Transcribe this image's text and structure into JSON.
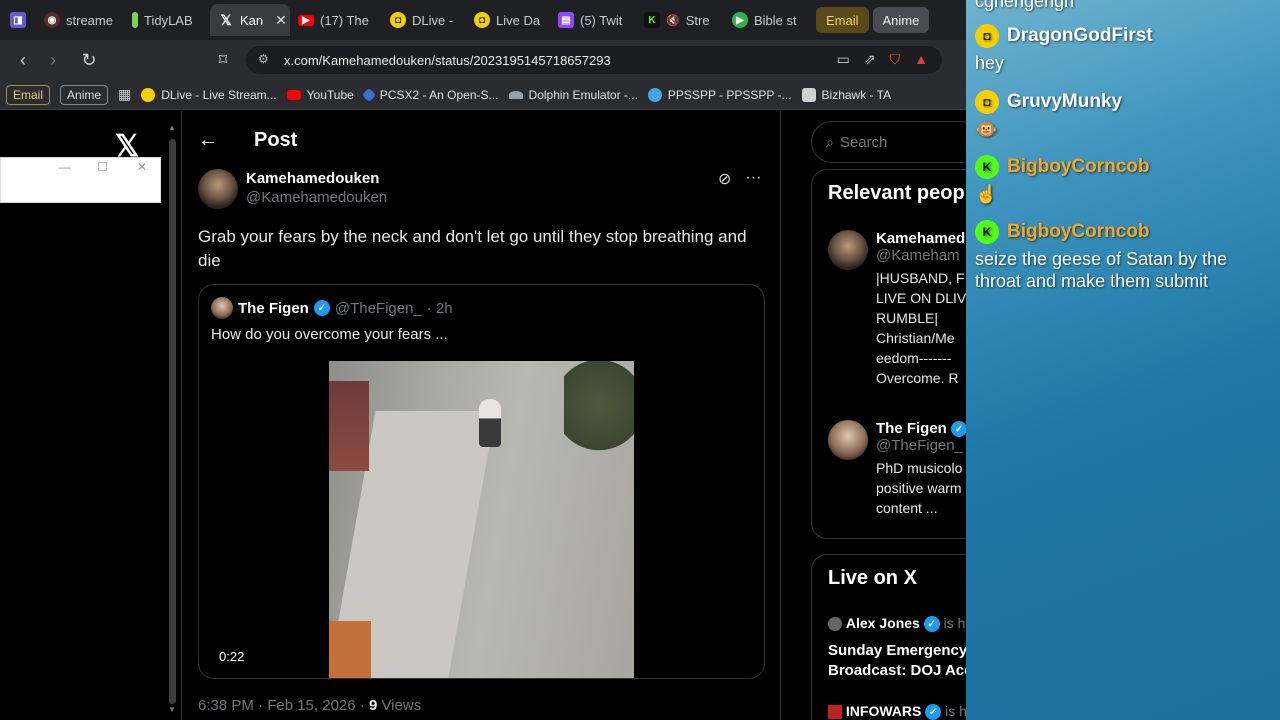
{
  "tabs": [
    {
      "label": "streame",
      "icon": "streamer-icon",
      "color": "#c4403a"
    },
    {
      "label": "TidyLAB",
      "icon": "flask-icon",
      "color": "#7bd44f"
    },
    {
      "label": "Kan",
      "icon": "x-logo-icon",
      "color": "#000000",
      "active": true
    },
    {
      "label": "(17) The",
      "icon": "youtube-icon",
      "color": "#ff0000"
    },
    {
      "label": "DLive -",
      "icon": "dlive-icon",
      "color": "#f5d000"
    },
    {
      "label": "Live Da",
      "icon": "dlive-icon",
      "color": "#f5d000"
    },
    {
      "label": "(5) Twit",
      "icon": "twitch-icon",
      "color": "#9146ff"
    },
    {
      "label": "Stre",
      "icon": "kick-icon",
      "color": "#53fc18"
    },
    {
      "label": "Bible st",
      "icon": "play-icon",
      "color": "#2fb34a"
    }
  ],
  "tab_pills": {
    "email": "Email",
    "anime": "Anime"
  },
  "address": {
    "url": "x.com/Kamehamedouken/status/2023195145718657293"
  },
  "bookmarks": {
    "email": "Email",
    "anime": "Anime",
    "items": [
      {
        "label": "DLive - Live Stream...",
        "icon": "dlive-icon",
        "color": "#f5d000"
      },
      {
        "label": "YouTube",
        "icon": "youtube-icon",
        "color": "#ff0000"
      },
      {
        "label": "PCSX2 - An Open-S...",
        "icon": "pcsx2-icon",
        "color": "#3b6fd6"
      },
      {
        "label": "Dolphin Emulator -...",
        "icon": "dolphin-icon",
        "color": "#9aa0a6"
      },
      {
        "label": "PPSSPP - PPSSPP -...",
        "icon": "ppsspp-icon",
        "color": "#4aa3e0"
      },
      {
        "label": "Bizhawk - TA",
        "icon": "bizhawk-icon",
        "color": "#d0d0d0"
      }
    ]
  },
  "post": {
    "header": "Post",
    "author_name": "Kamehamedouken",
    "author_handle": "@Kamehamedouken",
    "text": "Grab your fears by the neck and don't let go until they stop breathing and die",
    "quote": {
      "name": "The Figen",
      "handle": "@TheFigen_",
      "time": "· 2h",
      "text": "How do you overcome your fears ...",
      "video_time": "0:22"
    },
    "timestamp": "6:38 PM · Feb 15, 2026 · ",
    "views_count": "9",
    "views_label": " Views"
  },
  "sidebar": {
    "search_placeholder": "Search",
    "relevant_title": "Relevant peop",
    "relevant": [
      {
        "name": "Kamehamed",
        "handle": "@Kameham",
        "bio": "|HUSBAND, F\nLIVE ON DLIV\nRUMBLE|\nChristian/Me\needom-------\nOvercome. R"
      },
      {
        "name": "The Figen",
        "handle": "@TheFigen_",
        "bio": "PhD musicolo\npositive warm\ncontent ..."
      }
    ],
    "live_title": "Live on X",
    "live_host": "Alex Jones",
    "live_host_suffix": "is ho",
    "live_broadcast": "Sunday Emergency\nBroadcast: DOJ Acc",
    "live_host2": "INFOWARS",
    "live_host2_suffix": "is ho"
  },
  "chat": {
    "top_fragment": "cgnengengn",
    "messages": [
      {
        "user": "DragonGodFirst",
        "platform": "dlive",
        "user_color": "#ffffff",
        "text": "hey"
      },
      {
        "user": "GruvyMunky",
        "platform": "dlive",
        "user_color": "#ffffff",
        "text": "🐵"
      },
      {
        "user": "BigboyCorncob",
        "platform": "kick",
        "user_color": "#f5a623",
        "text": "☝"
      },
      {
        "user": "BigboyCorncob",
        "platform": "kick",
        "user_color": "#f5a623",
        "text": "seize the geese of Satan by the throat and make them submit"
      }
    ]
  },
  "colors": {
    "accent": "#1d9bf0",
    "kick": "#53fc18",
    "dlive": "#f5d000"
  }
}
